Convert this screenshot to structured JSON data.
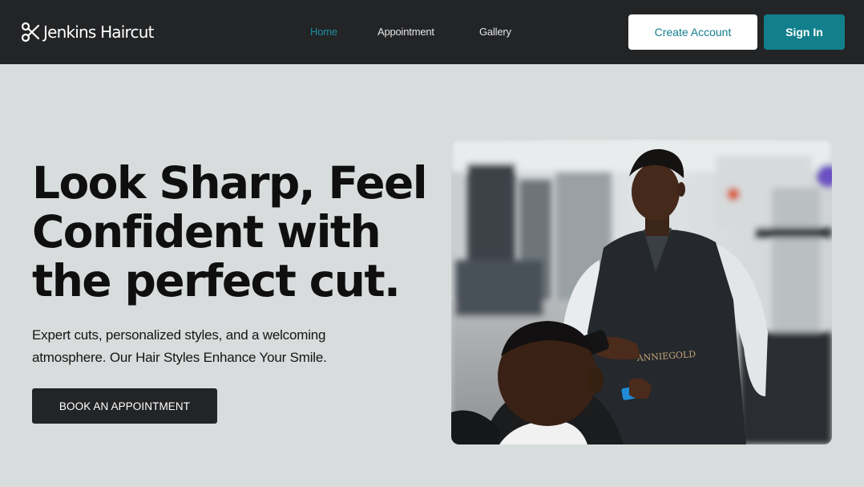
{
  "brand": {
    "name": "Jenkins Haircut",
    "icon": "scissors-icon"
  },
  "nav": {
    "links": [
      {
        "label": "Home",
        "active": true
      },
      {
        "label": "Appointment",
        "active": false
      },
      {
        "label": "Gallery",
        "active": false
      }
    ]
  },
  "actions": {
    "create_account": "Create Account",
    "sign_in": "Sign In"
  },
  "hero": {
    "title_lines": [
      "Look Sharp, Feel",
      "Confident with",
      "the perfect cut."
    ],
    "subtitle_lines": [
      "Expert cuts, personalized styles, and a welcoming",
      "atmosphere. Our Hair Styles Enhance Your Smile."
    ],
    "cta": "BOOK AN APPOINTMENT",
    "apron_text": "ANNIEGOLD"
  },
  "colors": {
    "nav_bg": "#232426",
    "page_bg": "#d9dcdc",
    "accent": "#127f8d",
    "active_link": "#1b8f9f",
    "dark_button": "#232426"
  }
}
